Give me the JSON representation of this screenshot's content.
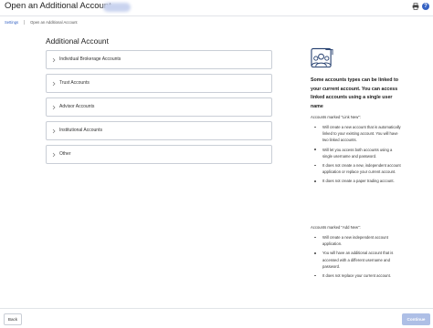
{
  "header": {
    "title": "Open an Additional Account",
    "print_icon": "print-icon",
    "help_icon": "help-icon",
    "help_glyph": "?"
  },
  "breadcrumb": {
    "items": [
      "Settings",
      "Open an Additional Account"
    ]
  },
  "main": {
    "title": "Additional Account",
    "accordion": [
      {
        "label": "Individual Brokerage Accounts"
      },
      {
        "label": "Trust Accounts"
      },
      {
        "label": "Advisor Accounts"
      },
      {
        "label": "Institutional Accounts"
      },
      {
        "label": "Other"
      }
    ]
  },
  "sidebar": {
    "icon": "people-group-icon",
    "heading": "Some accounts types can be linked to your current account. You can access linked accounts using a single user name",
    "link_new_title": "Accounts marked \"Link New\":",
    "link_new_points": [
      "Will create a new account that is automatically linked to your existing account. You will have two linked accounts.",
      "Will let you access both accounts using a single username and password.",
      "It does not create a new, independent account application or replace your current account.",
      "It does not create a paper trading account."
    ],
    "add_new_title": "Accounts marked \"Add New\":",
    "add_new_points": [
      "Will create a new independent account application.",
      "You will have an additional account that is accessed with a different username and password.",
      "It does not replace your current account."
    ]
  },
  "footer": {
    "back_label": "Back",
    "continue_label": "Continue"
  },
  "colors": {
    "accent": "#3562c3",
    "continue_disabled": "#aebfe6",
    "border": "#c9ced6"
  }
}
